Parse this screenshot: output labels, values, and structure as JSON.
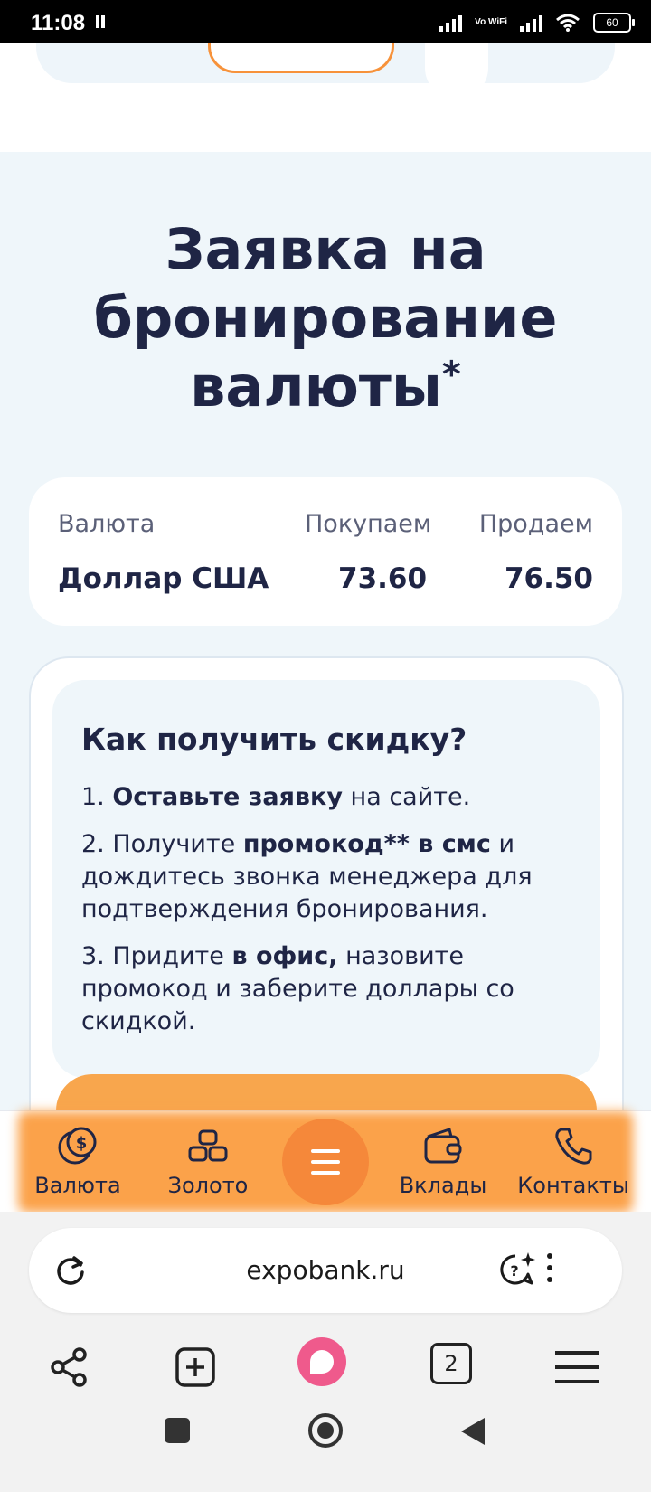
{
  "status_bar": {
    "time": "11:08",
    "network_label": "Vo WiFi",
    "battery": "60"
  },
  "page": {
    "title_line1": "Заявка на",
    "title_line2": "бронирование",
    "title_line3": "валюты",
    "title_mark": "*"
  },
  "rates": {
    "headers": {
      "currency": "Валюта",
      "buy": "Покупаем",
      "sell": "Продаем"
    },
    "row": {
      "currency": "Доллар США",
      "buy": "73.60",
      "sell": "76.50"
    }
  },
  "discount": {
    "title": "Как получить скидку?",
    "step1": {
      "num": "1. ",
      "bold": "Оставьте заявку",
      "rest": " на сайте."
    },
    "step2": {
      "num": "2. Получите ",
      "bold": "промокод** в смс",
      "rest": " и дождитесь звонка менеджера для подтверждения бронирования."
    },
    "step3": {
      "num": "3. Придите ",
      "bold": "в офис,",
      "rest": " назовите промокод и заберите доллары со скидкой."
    }
  },
  "bottom_nav": {
    "items": [
      {
        "label": "Валюта",
        "icon": "currency-coin-icon"
      },
      {
        "label": "Золото",
        "icon": "gold-bars-icon"
      },
      {
        "label": "Меню",
        "icon": "hamburger-menu-icon"
      },
      {
        "label": "Вклады",
        "icon": "wallet-icon"
      },
      {
        "label": "Контакты",
        "icon": "phone-icon"
      }
    ]
  },
  "browser": {
    "url": "expobank.ru",
    "tab_count": "2"
  },
  "colors": {
    "accent_orange": "#f7923a",
    "text_dark": "#1f2545",
    "section_bg": "#eff6fa"
  }
}
